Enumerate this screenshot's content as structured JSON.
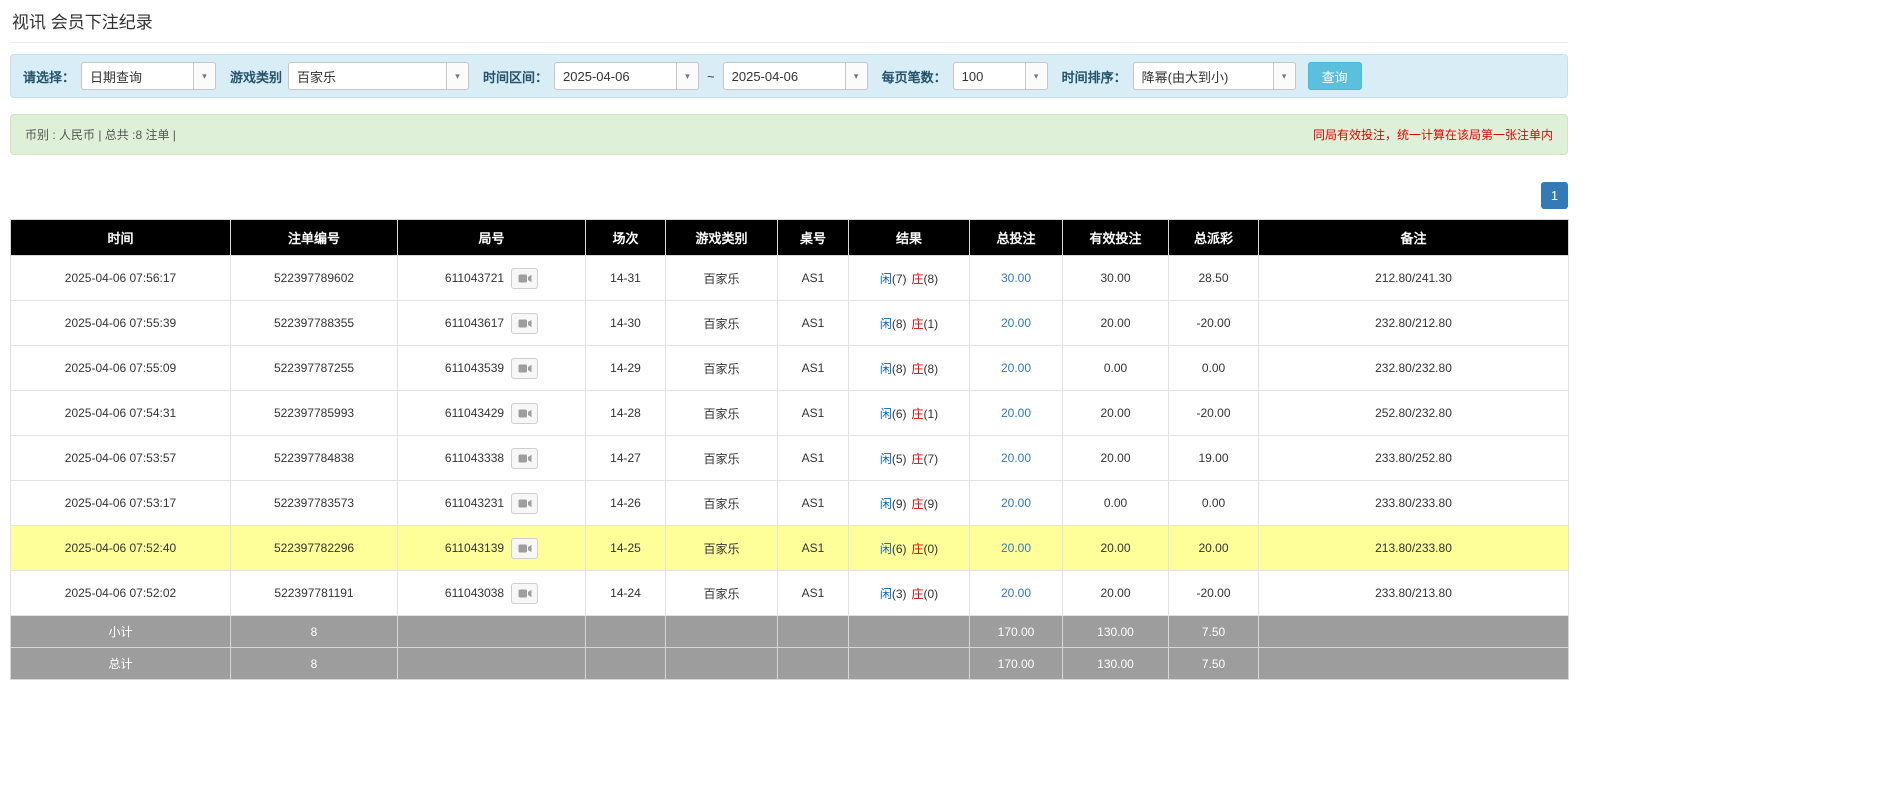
{
  "page": {
    "title": "视讯 会员下注纪录"
  },
  "filter_bar": {
    "select_label": "请选择：",
    "select_value": "日期查询",
    "game_type_label": "游戏类别",
    "game_type_value": "百家乐",
    "time_range_label": "时间区间：",
    "date_from": "2025-04-06",
    "range_separator": "~",
    "date_to": "2025-04-06",
    "page_size_label": "每页笔数：",
    "page_size_value": "100",
    "sort_label": "时间排序：",
    "sort_value": "降幂(由大到小)",
    "search_button_label": "查询"
  },
  "summary_bar": {
    "left_text": "币别 : 人民币 | 总共 :8 注单 |",
    "right_text": "同局有效投注，统一计算在该局第一张注单内"
  },
  "pagination": {
    "current_page": "1"
  },
  "table": {
    "headers": [
      "时间",
      "注单编号",
      "局号",
      "场次",
      "游戏类别",
      "桌号",
      "结果",
      "总投注",
      "有效投注",
      "总派彩",
      "备注"
    ],
    "rows": [
      {
        "time": "2025-04-06 07:56:17",
        "bet_id": "522397789602",
        "round_id": "611043721",
        "session": "14-31",
        "game": "百家乐",
        "table_no": "AS1",
        "player": "闲",
        "player_score": "(7)",
        "banker": "庄",
        "banker_score": "(8)",
        "total_bet": "30.00",
        "valid_bet": "30.00",
        "payout": "28.50",
        "note": "212.80/241.30",
        "highlight": false
      },
      {
        "time": "2025-04-06 07:55:39",
        "bet_id": "522397788355",
        "round_id": "611043617",
        "session": "14-30",
        "game": "百家乐",
        "table_no": "AS1",
        "player": "闲",
        "player_score": "(8)",
        "banker": "庄",
        "banker_score": "(1)",
        "total_bet": "20.00",
        "valid_bet": "20.00",
        "payout": "-20.00",
        "note": "232.80/212.80",
        "highlight": false
      },
      {
        "time": "2025-04-06 07:55:09",
        "bet_id": "522397787255",
        "round_id": "611043539",
        "session": "14-29",
        "game": "百家乐",
        "table_no": "AS1",
        "player": "闲",
        "player_score": "(8)",
        "banker": "庄",
        "banker_score": "(8)",
        "total_bet": "20.00",
        "valid_bet": "0.00",
        "payout": "0.00",
        "note": "232.80/232.80",
        "highlight": false
      },
      {
        "time": "2025-04-06 07:54:31",
        "bet_id": "522397785993",
        "round_id": "611043429",
        "session": "14-28",
        "game": "百家乐",
        "table_no": "AS1",
        "player": "闲",
        "player_score": "(6)",
        "banker": "庄",
        "banker_score": "(1)",
        "total_bet": "20.00",
        "valid_bet": "20.00",
        "payout": "-20.00",
        "note": "252.80/232.80",
        "highlight": false
      },
      {
        "time": "2025-04-06 07:53:57",
        "bet_id": "522397784838",
        "round_id": "611043338",
        "session": "14-27",
        "game": "百家乐",
        "table_no": "AS1",
        "player": "闲",
        "player_score": "(5)",
        "banker": "庄",
        "banker_score": "(7)",
        "total_bet": "20.00",
        "valid_bet": "20.00",
        "payout": "19.00",
        "note": "233.80/252.80",
        "highlight": false
      },
      {
        "time": "2025-04-06 07:53:17",
        "bet_id": "522397783573",
        "round_id": "611043231",
        "session": "14-26",
        "game": "百家乐",
        "table_no": "AS1",
        "player": "闲",
        "player_score": "(9)",
        "banker": "庄",
        "banker_score": "(9)",
        "total_bet": "20.00",
        "valid_bet": "0.00",
        "payout": "0.00",
        "note": "233.80/233.80",
        "highlight": false
      },
      {
        "time": "2025-04-06 07:52:40",
        "bet_id": "522397782296",
        "round_id": "611043139",
        "session": "14-25",
        "game": "百家乐",
        "table_no": "AS1",
        "player": "闲",
        "player_score": "(6)",
        "banker": "庄",
        "banker_score": "(0)",
        "total_bet": "20.00",
        "valid_bet": "20.00",
        "payout": "20.00",
        "note": "213.80/233.80",
        "highlight": true
      },
      {
        "time": "2025-04-06 07:52:02",
        "bet_id": "522397781191",
        "round_id": "611043038",
        "session": "14-24",
        "game": "百家乐",
        "table_no": "AS1",
        "player": "闲",
        "player_score": "(3)",
        "banker": "庄",
        "banker_score": "(0)",
        "total_bet": "20.00",
        "valid_bet": "20.00",
        "payout": "-20.00",
        "note": "233.80/213.80",
        "highlight": false
      }
    ],
    "summary_rows": [
      {
        "label": "小计",
        "count": "8",
        "total_bet": "170.00",
        "valid_bet": "130.00",
        "payout": "7.50"
      },
      {
        "label": "总计",
        "count": "8",
        "total_bet": "170.00",
        "valid_bet": "130.00",
        "payout": "7.50"
      }
    ]
  },
  "colors": {
    "accent_blue": "#337ab7",
    "player_blue": "#0066cc",
    "banker_red": "#e60000",
    "negative_red": "#e60000",
    "highlight_yellow": "#ffff99",
    "table_header_bg": "#000000",
    "summary_row_bg": "#9d9d9d",
    "filter_bar_bg": "#d9edf7",
    "summary_bar_bg": "#dff0d8",
    "search_button_bg": "#5bc0de"
  }
}
